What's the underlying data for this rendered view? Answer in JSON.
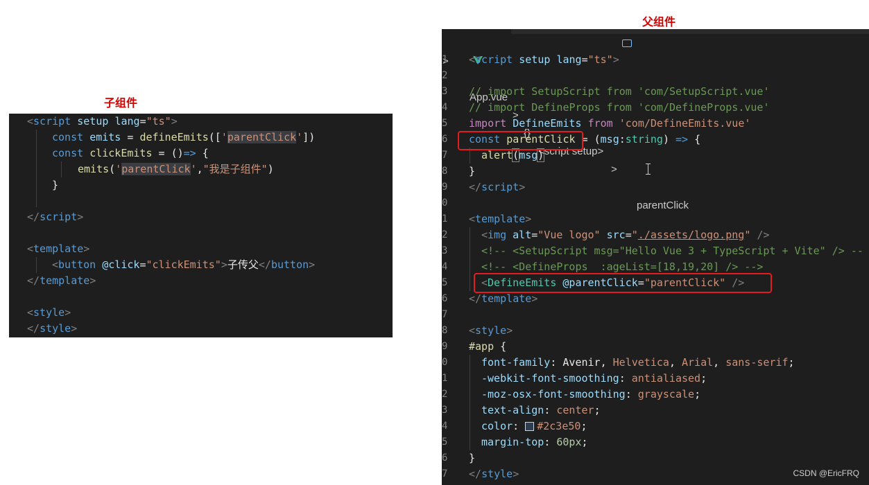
{
  "captions": {
    "child": "子组件",
    "parent": "父组件"
  },
  "child_code": {
    "l1": {
      "open": "<",
      "tag": "script",
      "attr1": "setup",
      "attr2": "lang",
      "eq": "=",
      "val": "\"ts\"",
      "close": ">"
    },
    "l2": {
      "kw": "const",
      "name": "emits",
      "eq": "=",
      "fn": "defineEmits",
      "p1": "([",
      "q1": "'",
      "hl": "parentClick",
      "q2": "'",
      "p2": "])"
    },
    "l3": {
      "kw": "const",
      "name": "clickEmits",
      "rest": "= ()",
      "arrow": "=>",
      "brace": "{"
    },
    "l4": {
      "fn": "emits",
      "p1": "(",
      "q1": "'",
      "hl": "parentClick",
      "q2": "'",
      "comma": ",",
      "str": "\"我是子组件\"",
      "p2": ")"
    },
    "l5": {
      "brace": "}"
    },
    "l6": {
      "open": "</",
      "tag": "script",
      "close": ">"
    },
    "l7": {
      "open": "<",
      "tag": "template",
      "close": ">"
    },
    "l8": {
      "open": "<",
      "tag": "button",
      "attr": "@click",
      "eq": "=",
      "val": "\"clickEmits\"",
      "close": ">",
      "text": "子传父",
      "open2": "</",
      "tag2": "button",
      "close2": ">"
    },
    "l9": {
      "open": "</",
      "tag": "template",
      "close": ">"
    },
    "l10": {
      "open": "<",
      "tag": "style",
      "close": ">"
    },
    "l11": {
      "open": "</",
      "tag": "style",
      "close": ">"
    }
  },
  "parent_editor": {
    "breadcrumb": {
      "file": "App.vue",
      "section": "<script setup>",
      "symbol": "parentClick",
      "sep": ">",
      "braces": "{}"
    },
    "line_numbers": [
      "1",
      "2",
      "3",
      "4",
      "5",
      "6",
      "7",
      "8",
      "9",
      "0",
      "1",
      "2",
      "3",
      "4",
      "5",
      "6",
      "7",
      "8",
      "9",
      "0",
      "1",
      "2",
      "3",
      "4",
      "5",
      "6",
      "7"
    ],
    "lines": {
      "l1": {
        "open": "<",
        "tag": "script",
        "attr1": "setup",
        "attr2": "lang",
        "eq": "=",
        "val": "\"ts\"",
        "close": ">"
      },
      "l3": {
        "comment": "// import SetupScript from 'com/SetupScript.vue'"
      },
      "l4": {
        "comment": "// import DefineProps from 'com/DefineProps.vue'"
      },
      "l5": {
        "kw": "import",
        "name": "DefineEmits",
        "from": "from",
        "str": "'com/DefineEmits.vue'"
      },
      "l6": {
        "kw": "const",
        "name": "parentClick",
        "eq": "=",
        "p1": "(",
        "param": "msg",
        "colon": ":",
        "type": "string",
        "p2": ")",
        "arrow": "=>",
        "brace": "{"
      },
      "l7": {
        "fn": "alert",
        "p1": "(",
        "arg": "msg",
        "p2": ")"
      },
      "l8": {
        "brace": "}"
      },
      "l9": {
        "open": "</",
        "tag": "script",
        "close": ">"
      },
      "l11": {
        "open": "<",
        "tag": "template",
        "close": ">"
      },
      "l12": {
        "open": "<",
        "tag": "img",
        "attr1": "alt",
        "val1": "\"Vue logo\"",
        "attr2": "src",
        "q1": "\"",
        "link": "./assets/logo.png",
        "q2": "\"",
        "close": "/>"
      },
      "l13": {
        "comment": "<!-- <SetupScript msg=\"Hello Vue 3 + TypeScript + Vite\" /> --"
      },
      "l14": {
        "comment": "<!-- <DefineProps  :ageList=[18,19,20] /> -->"
      },
      "l15": {
        "open": "<",
        "tag": "DefineEmits",
        "attr": "@parentClick",
        "eq": "=",
        "val": "\"parentClick\"",
        "close": "/>"
      },
      "l16": {
        "open": "</",
        "tag": "template",
        "close": ">"
      },
      "l18": {
        "open": "<",
        "tag": "style",
        "close": ">"
      },
      "l19": {
        "sel": "#app",
        "brace": "{"
      },
      "l20": {
        "prop": "font-family",
        "v1": "Avenir",
        "v2": "Helvetica",
        "v3": "Arial",
        "v4": "sans-serif"
      },
      "l21": {
        "prop": "-webkit-font-smoothing",
        "val": "antialiased"
      },
      "l22": {
        "prop": "-moz-osx-font-smoothing",
        "val": "grayscale"
      },
      "l23": {
        "prop": "text-align",
        "val": "center"
      },
      "l24": {
        "prop": "color",
        "val": "#2c3e50",
        "swatch": "#2c3e50"
      },
      "l25": {
        "prop": "margin-top",
        "val": "60px"
      },
      "l26": {
        "brace": "}"
      },
      "l27": {
        "open": "</",
        "tag": "style",
        "close": ">"
      }
    }
  },
  "watermark": "CSDN @EricFRQ",
  "colors": {
    "editor_bg": "#1e1e1e",
    "highlight_box": "#e51c1c",
    "caption": "#d40000"
  }
}
